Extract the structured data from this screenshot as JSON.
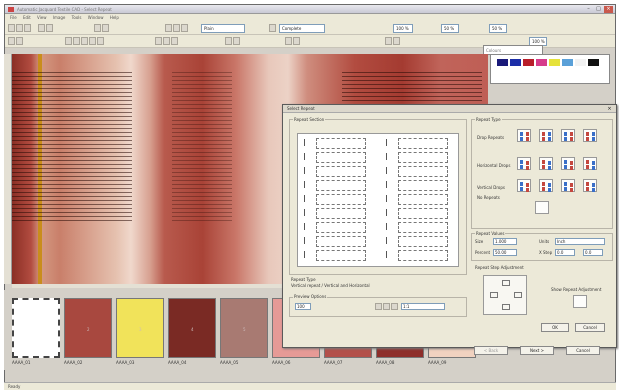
{
  "app": {
    "title": "Automatic Jacquard Textile CAD - Select Repeat",
    "status": "Ready"
  },
  "menu": [
    "File",
    "Edit",
    "View",
    "Image",
    "Tools",
    "Window",
    "Help"
  ],
  "toolbar": {
    "mode_select": "Plain",
    "layer_select": "Complete",
    "zoom1": "100 %",
    "zoom2": "50 %",
    "zoom3": "50 %",
    "zoom4": "100 %"
  },
  "side_tab": "Colours",
  "palette_colors": [
    "#1a1a7a",
    "#1c2ea8",
    "#b81e2a",
    "#d63c8c",
    "#e6e23a",
    "#5aa0d8",
    "#f2f2f2",
    "#111111"
  ],
  "dialog": {
    "title": "Select Repeat",
    "repeat_section": "Repeat Section",
    "repeat_type": "Repeat Type",
    "drop_repeats": "Drop Repeats",
    "half_drop": "Horizontal Drops",
    "vertical_drop": "Vertical Drops",
    "no_repeats": "No Repeats",
    "repeat_values": "Repeat Values",
    "size_label": "Size",
    "size_value": "1.000",
    "percent_label": "Percent",
    "percent_value": "50.00",
    "units_label": "Units",
    "units_value": "Inch",
    "x_step_label": "X Step",
    "x_step_value": "0.0",
    "y_step_value": "0.0",
    "adjust_label": "Repeat Step Adjustment",
    "preview_section": "Preview Options",
    "repeat_type_footer": "Repeat Type",
    "repeat_type_desc": "Vertical repeat / Vertical and Horizontal",
    "zoom_value": "100",
    "zoom_select": "1:1",
    "show_label": "Show Repeat Adjustment",
    "ok": "OK",
    "cancel": "Cancel",
    "back": "< Back",
    "next": "Next >",
    "cancel2": "Cancel",
    "finish": "Finish"
  },
  "thumbnails": [
    {
      "label": "AAAA_01",
      "color": "#ffffff",
      "num": ""
    },
    {
      "label": "AAAA_02",
      "color": "#a8483f",
      "num": "2"
    },
    {
      "label": "AAAA_03",
      "color": "#f1e35a",
      "num": "3"
    },
    {
      "label": "AAAA_04",
      "color": "#7a2a24",
      "num": "4"
    },
    {
      "label": "AAAA_05",
      "color": "#a87a72",
      "num": "5"
    },
    {
      "label": "AAAA_06",
      "color": "#e69a96",
      "num": ""
    },
    {
      "label": "AAAA_07",
      "color": "#b3504a",
      "num": ""
    },
    {
      "label": "AAAA_08",
      "color": "#8e2e2a",
      "num": ""
    },
    {
      "label": "AAAA_09",
      "color": "#f1d2c0",
      "num": ""
    }
  ]
}
